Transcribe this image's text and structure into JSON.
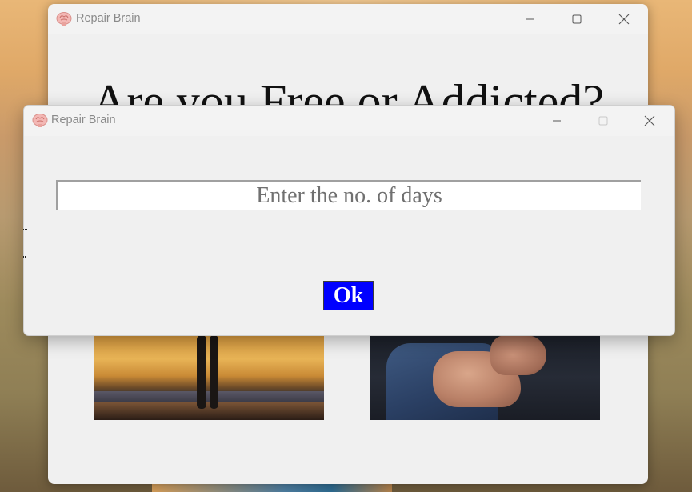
{
  "main_window": {
    "title": "Repair Brain",
    "heading": "Are you Free or Addicted?",
    "app_icon": "brain-icon",
    "controls": [
      "minimize-icon",
      "maximize-icon",
      "close-icon"
    ]
  },
  "dialog_window": {
    "title": "Repair Brain",
    "app_icon": "brain-icon",
    "controls": [
      "minimize-icon",
      "maximize-icon",
      "close-icon"
    ],
    "days_input": {
      "value": "",
      "placeholder": "Enter the no. of days"
    },
    "ok_label": "Ok",
    "colors": {
      "ok_background": "#0000ff",
      "ok_text": "#ffffff"
    }
  }
}
